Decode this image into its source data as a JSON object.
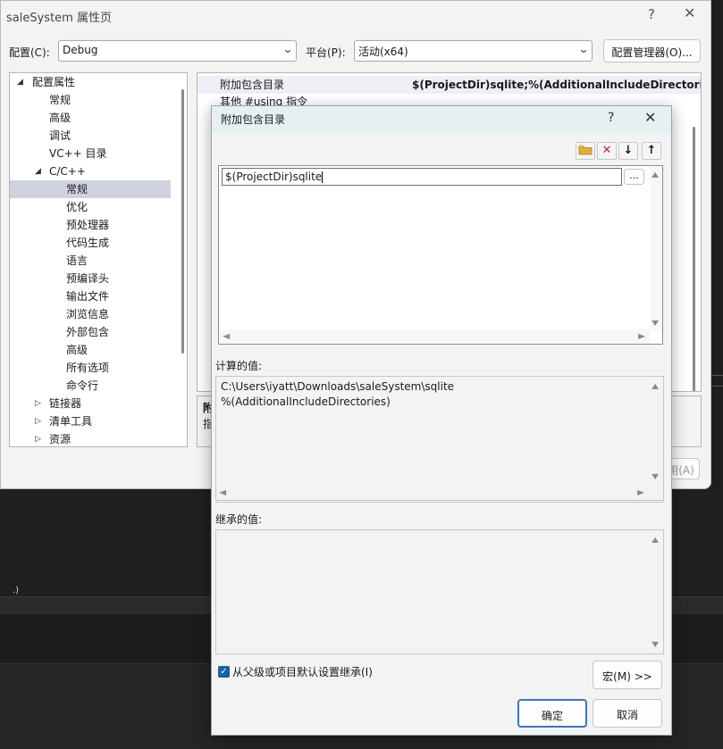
{
  "window": {
    "title": "saleSystem 属性页",
    "help_label": "?",
    "close_label": "✕",
    "config_label": "配置(C):",
    "config_value": "Debug",
    "platform_label": "平台(P):",
    "platform_value": "活动(x64)",
    "config_manager_label": "配置管理器(O)...",
    "apply_label": "用(A)"
  },
  "tree": {
    "items": [
      {
        "label": "配置属性"
      },
      {
        "label": "常规"
      },
      {
        "label": "高级"
      },
      {
        "label": "调试"
      },
      {
        "label": "VC++ 目录"
      },
      {
        "label": "C/C++"
      },
      {
        "label": "常规"
      },
      {
        "label": "优化"
      },
      {
        "label": "预处理器"
      },
      {
        "label": "代码生成"
      },
      {
        "label": "语言"
      },
      {
        "label": "预编译头"
      },
      {
        "label": "输出文件"
      },
      {
        "label": "浏览信息"
      },
      {
        "label": "外部包含"
      },
      {
        "label": "高级"
      },
      {
        "label": "所有选项"
      },
      {
        "label": "命令行"
      },
      {
        "label": "链接器"
      },
      {
        "label": "清单工具"
      },
      {
        "label": "资源"
      }
    ]
  },
  "grid": {
    "rows": [
      {
        "name": "附加包含目录",
        "value": "$(ProjectDir)sqlite;%(AdditionalIncludeDirectories)"
      },
      {
        "name": "其他 #using 指令",
        "value": ""
      }
    ]
  },
  "desc": {
    "title": "附",
    "body": "指"
  },
  "dialog": {
    "title": "附加包含目录",
    "help_label": "?",
    "close_label": "✕",
    "toolbar": {
      "new_line": "new-line",
      "delete": "✕",
      "move_down": "↓",
      "move_up": "↑"
    },
    "edit_value": "$(ProjectDir)sqlite",
    "browse_label": "...",
    "computed_label": "计算的值:",
    "computed_lines": [
      "C:\\Users\\iyatt\\Downloads\\saleSystem\\sqlite",
      "%(AdditionalIncludeDirectories)"
    ],
    "inherited_label": "继承的值:",
    "inherit_checkbox_label": "从父级或项目默认设置继承(I)",
    "macro_label": "宏(M) >>",
    "ok_label": "确定",
    "cancel_label": "取消"
  },
  "colors": {
    "accent": "#1d5ea7",
    "selection": "#d0d2e0",
    "dialog_header": "#e6f0f3"
  }
}
